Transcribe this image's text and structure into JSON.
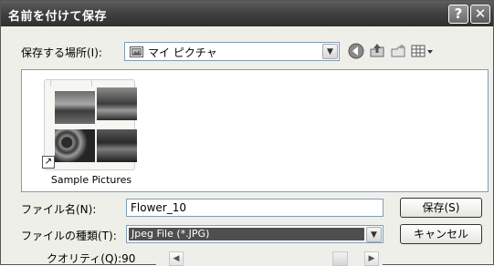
{
  "window": {
    "title": "名前を付けて保存",
    "help_glyph": "?",
    "close_glyph": "✕"
  },
  "location": {
    "label": "保存する場所(I):",
    "value": "マイ ピクチャ",
    "icon": "my-pictures-folder-icon",
    "toolbar_icons": [
      "back-icon",
      "up-folder-icon",
      "new-folder-icon",
      "view-menu-icon"
    ]
  },
  "file_list": {
    "items": [
      {
        "label": "Sample Pictures",
        "icon": "folder-with-thumbnails-icon",
        "badge": "shortcut-arrow-icon"
      }
    ]
  },
  "filename": {
    "label": "ファイル名(N):",
    "value": "Flower_10"
  },
  "filetype": {
    "label": "ファイルの種類(T):",
    "value": "Jpeg File (*.JPG)"
  },
  "quality": {
    "label": "クオリティ(Q):90",
    "value": 90
  },
  "buttons": {
    "save": "保存(S)",
    "cancel": "キャンセル"
  },
  "arrows": {
    "combo": "▼",
    "left": "◀",
    "right": "▶",
    "shortcut": "↗"
  }
}
